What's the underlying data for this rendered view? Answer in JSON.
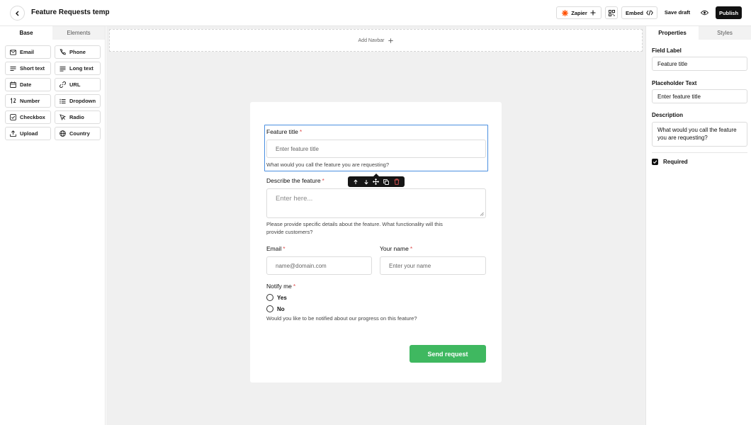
{
  "header": {
    "title": "Feature Requests template",
    "zapier_label": "Zapier",
    "embed_label": "Embed",
    "save_draft_label": "Save draft",
    "publish_label": "Publish"
  },
  "left_sidebar": {
    "tabs": [
      {
        "label": "Base",
        "active": true
      },
      {
        "label": "Elements",
        "active": false
      }
    ],
    "elements": [
      {
        "label": "Email",
        "icon": "mail-icon"
      },
      {
        "label": "Phone",
        "icon": "phone-icon"
      },
      {
        "label": "Short text",
        "icon": "short-text-icon"
      },
      {
        "label": "Long text",
        "icon": "long-text-icon"
      },
      {
        "label": "Date",
        "icon": "calendar-icon"
      },
      {
        "label": "URL",
        "icon": "link-icon"
      },
      {
        "label": "Number",
        "icon": "number-icon"
      },
      {
        "label": "Dropdown",
        "icon": "list-icon"
      },
      {
        "label": "Checkbox",
        "icon": "checkbox-icon"
      },
      {
        "label": "Radio",
        "icon": "cursor-icon"
      },
      {
        "label": "Upload",
        "icon": "upload-icon"
      },
      {
        "label": "Country",
        "icon": "globe-icon"
      }
    ]
  },
  "canvas": {
    "add_navbar_label": "Add Navbar",
    "form": {
      "feature_title": {
        "label": "Feature title",
        "required_mark": "*",
        "placeholder": "Enter feature title",
        "help": "What would you call the feature you are requesting?"
      },
      "describe": {
        "label": "Describe the feature",
        "required_mark": "*",
        "placeholder": "Enter here...",
        "help_line1": "Please provide specific details about the feature. What functionality will this",
        "help_line2": "provide customers?"
      },
      "email": {
        "label": "Email",
        "required_mark": "*",
        "placeholder": "name@domain.com"
      },
      "your_name": {
        "label": "Your name",
        "required_mark": "*",
        "placeholder": "Enter your name"
      },
      "notify": {
        "label": "Notify me",
        "required_mark": "*",
        "options": [
          "Yes",
          "No"
        ],
        "help": "Would you like to be notified about our progress on this feature?"
      },
      "submit_label": "Send request"
    }
  },
  "right_sidebar": {
    "tabs": [
      {
        "label": "Properties",
        "active": true
      },
      {
        "label": "Styles",
        "active": false
      }
    ],
    "field_label_heading": "Field Label",
    "field_label_value": "Feature title",
    "placeholder_heading": "Placeholder Text",
    "placeholder_value": "Enter feature title",
    "description_heading": "Description",
    "description_value": "What would you call the feature you are requesting?",
    "required_label": "Required"
  },
  "colors": {
    "accent_green": "#3fb860",
    "selection_blue": "#4a8fe0",
    "required_red": "#e05252",
    "zapier_orange": "#ff4f00"
  }
}
